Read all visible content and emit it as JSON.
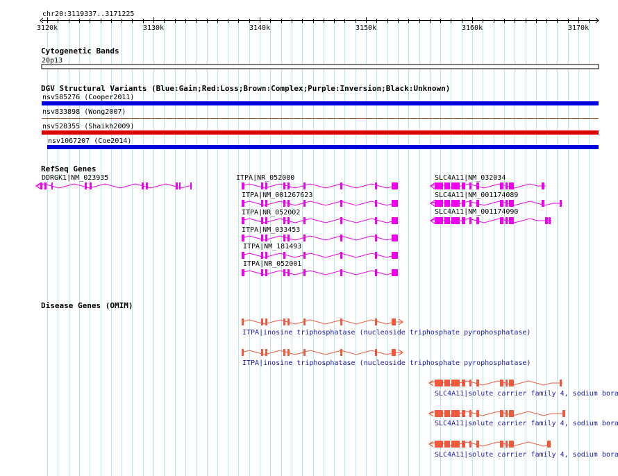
{
  "locus": "chr20:3119337..3171225",
  "ruler": {
    "ticks": [
      {
        "pos": 3120000,
        "label": "3120k"
      },
      {
        "pos": 3130000,
        "label": "3130k"
      },
      {
        "pos": 3140000,
        "label": "3140k"
      },
      {
        "pos": 3150000,
        "label": "3150k"
      },
      {
        "pos": 3160000,
        "label": "3160k"
      },
      {
        "pos": 3170000,
        "label": "3170k"
      }
    ]
  },
  "tracks": {
    "cytoband": {
      "title": "Cytogenetic Bands",
      "band": "20p13"
    },
    "dgv": {
      "title": "DGV Structural Variants (Blue:Gain;Red:Loss;Brown:Complex;Purple:Inversion;Black:Unknown)",
      "variants": [
        {
          "label": "nsv585276 (Cooper2011)",
          "type": "gain",
          "color": "#0000dd"
        },
        {
          "label": "nsv833898 (Wong2007)",
          "type": "complex",
          "color": "#8b4513"
        },
        {
          "label": "nsv528355 (Shaikh2009)",
          "type": "loss",
          "color": "#dd0000"
        },
        {
          "label": "nsv1067207 (Coe2014)",
          "type": "gain",
          "color": "#0000dd"
        }
      ]
    },
    "refseq": {
      "title": "RefSeq Genes",
      "color": "#ee00ee",
      "genes": [
        {
          "label": "DDRGK1|NM_023935"
        },
        {
          "label": "ITPA|NR_052000"
        },
        {
          "label": "ITPA|NM_001267623"
        },
        {
          "label": "ITPA|NR_052002"
        },
        {
          "label": "ITPA|NM_033453"
        },
        {
          "label": "ITPA|NM_181493"
        },
        {
          "label": "ITPA|NR_052001"
        },
        {
          "label": "SLC4A11|NM_032034"
        },
        {
          "label": "SLC4A11|NM_001174089"
        },
        {
          "label": "SLC4A11|NM_001174090"
        }
      ]
    },
    "omim": {
      "title": "Disease Genes (OMIM)",
      "color": "#f05a3c",
      "genes": [
        {
          "label": "ITPA|inosine triphosphatase (nucleoside triphosphate pyrophosphatase)"
        },
        {
          "label": "ITPA|inosine triphosphatase (nucleoside triphosphate pyrophosphatase)"
        },
        {
          "label": "SLC4A11|solute carrier family 4, sodium bora"
        },
        {
          "label": "SLC4A11|solute carrier family 4, sodium bora"
        },
        {
          "label": "SLC4A11|solute carrier family 4, sodium bora"
        }
      ]
    }
  }
}
